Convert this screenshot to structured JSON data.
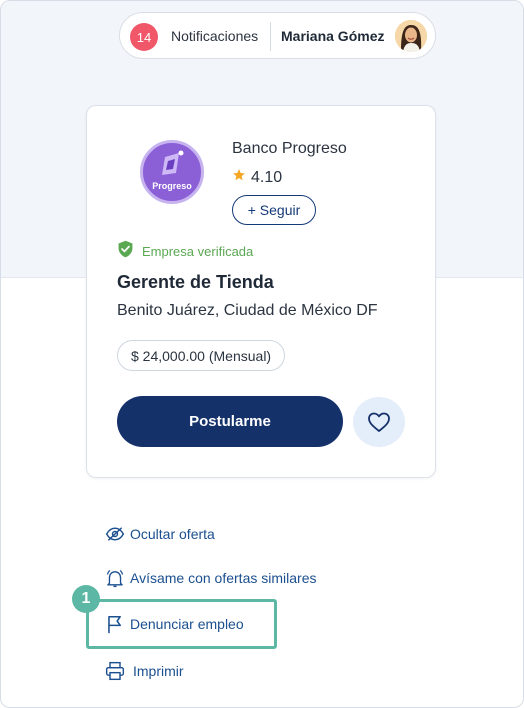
{
  "header": {
    "notifications_count": "14",
    "notifications_label": "Notificaciones",
    "user_name": "Mariana Gómez"
  },
  "job": {
    "company": "Banco Progreso",
    "company_logo_text": "Progreso",
    "rating": "4.10",
    "follow_label": "+ Seguir",
    "verified_label": "Empresa verificada",
    "title": "Gerente de Tienda",
    "location": "Benito Juárez, Ciudad de México DF",
    "salary": "$ 24,000.00 (Mensual)",
    "apply_label": "Postularme"
  },
  "actions": {
    "hide": "Ocultar oferta",
    "alert": "Avísame con ofertas similares",
    "report": "Denunciar empleo",
    "print": "Imprimir"
  },
  "tutorial": {
    "step": "1"
  },
  "colors": {
    "primary": "#14316a",
    "link": "#1b4f8f",
    "verified": "#5aa852",
    "highlight": "#5cb8a4",
    "badge": "#f0586a"
  }
}
